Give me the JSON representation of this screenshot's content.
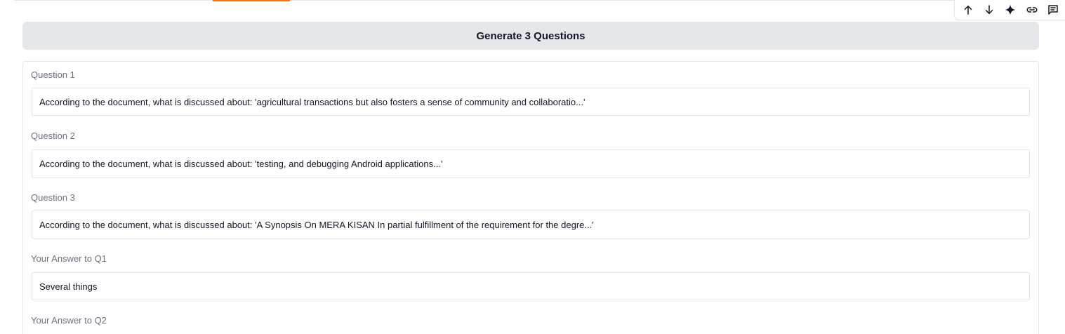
{
  "toolbar": {
    "icons": [
      "arrow-up-icon",
      "arrow-down-icon",
      "sparkle-icon",
      "link-icon",
      "comment-icon"
    ]
  },
  "generate_button": {
    "label": "Generate 3 Questions"
  },
  "questions": [
    {
      "label": "Question 1",
      "value": "According to the document, what is discussed about: 'agricultural transactions but also fosters a sense of community and collaboratio...'"
    },
    {
      "label": "Question 2",
      "value": "According to the document, what is discussed about: 'testing, and debugging Android applications...'"
    },
    {
      "label": "Question 3",
      "value": "According to the document, what is discussed about: 'A Synopsis On MERA KISAN In partial fulfillment of the requirement for the degre...'"
    }
  ],
  "answers": [
    {
      "label": "Your Answer to Q1",
      "value": "Several things"
    },
    {
      "label": "Your Answer to Q2",
      "value": ""
    }
  ],
  "colors": {
    "accent": "#f97316",
    "button_bg": "#e5e7eb",
    "label": "#6b7280"
  }
}
